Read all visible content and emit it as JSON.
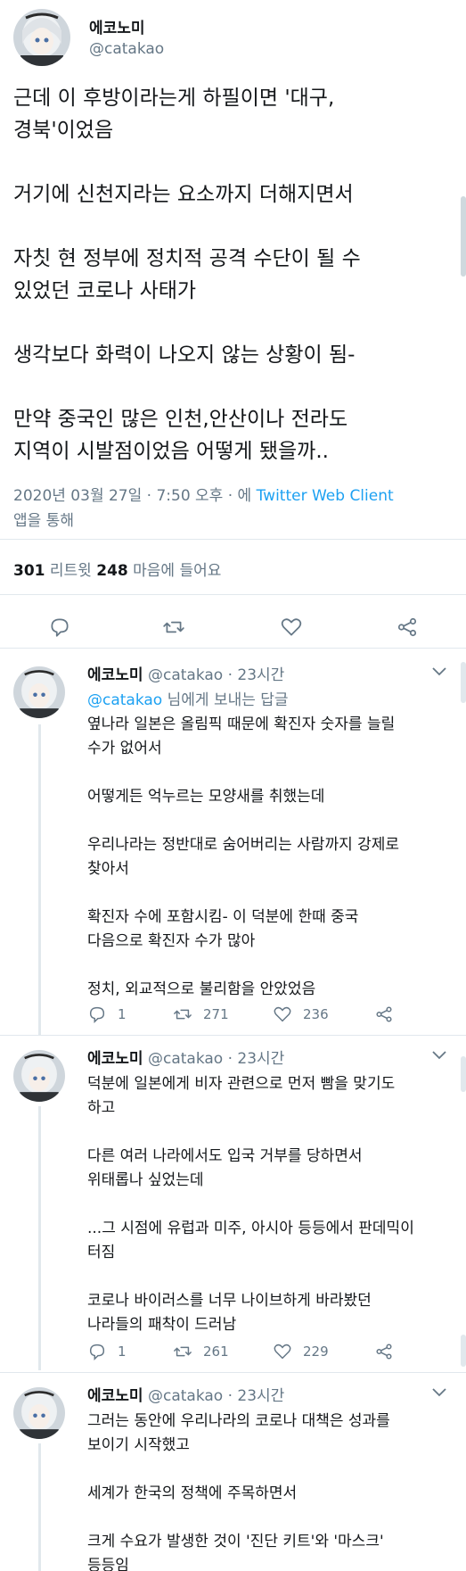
{
  "main_tweet": {
    "author_name": "에코노미",
    "author_handle": "@catakao",
    "lines": [
      "근데 이 후방이라는게 하필이면 '대구,",
      "경북'이었음",
      "",
      "거기에 신천지라는 요소까지 더해지면서",
      "",
      "자칫 현 정부에 정치적 공격 수단이 될 수",
      "있었던 코로나 사태가",
      "",
      "생각보다 화력이 나오지 않는 상황이 됨-",
      "",
      "만약 중국인 많은 인천,안산이나 전라도",
      "지역이 시발점이었음 어떻게 됐을까.."
    ],
    "timestamp": "2020년 03월 27일 · 7:50 오후 · 에 ",
    "client": "Twitter Web Client",
    "via": "앱을 통해",
    "retweet_count": "301",
    "retweet_label": " 리트윗 ",
    "like_count": "248",
    "like_label": " 마음에 들어요"
  },
  "replies": [
    {
      "author_name": "에코노미",
      "author_handle": "@catakao · 23시간",
      "replying_mention": "@catakao",
      "replying_suffix": " 님에게 보내는 답글",
      "lines": [
        "옆나라 일본은 올림픽 때문에 확진자 숫자를 늘릴",
        "수가 없어서",
        "",
        "어떻게든 억누르는 모양새를 취했는데",
        "",
        "우리나라는 정반대로 숨어버리는 사람까지 강제로",
        "찾아서",
        "",
        "확진자 수에 포함시킴- 이 덕분에 한때 중국",
        "다음으로 확진자 수가 많아",
        "",
        "정치, 외교적으로 불리함을 안았었음"
      ],
      "reply_count": "1",
      "retweet_count": "271",
      "like_count": "236"
    },
    {
      "author_name": "에코노미",
      "author_handle": "@catakao · 23시간",
      "lines": [
        "덕분에 일본에게 비자 관련으로 먼저 빰을 맞기도",
        "하고",
        "",
        "다른 여러 나라에서도 입국 거부를 당하면서",
        "위태롭나 싶었는데",
        "",
        "...그 시점에 유럽과 미주, 아시아 등등에서 판데믹이",
        "터짐",
        "",
        "코로나 바이러스를 너무 나이브하게 바라봤던",
        "나라들의 패착이 드러남"
      ],
      "reply_count": "1",
      "retweet_count": "261",
      "like_count": "229"
    },
    {
      "author_name": "에코노미",
      "author_handle": "@catakao · 23시간",
      "lines": [
        "그러는 동안에 우리나라의 코로나 대책은 성과를",
        "보이기 시작했고",
        "",
        "세계가 한국의 정책에 주목하면서",
        "",
        "크게 수요가 발생한 것이 '진단 키트'와 '마스크'",
        "등등임"
      ]
    }
  ],
  "icons": {
    "reply": "reply-icon",
    "retweet": "retweet-icon",
    "like": "heart-icon",
    "share": "share-icon"
  },
  "colors": {
    "link": "#1da1f2",
    "secondary_text": "#657786",
    "divider": "#e1e8ed"
  }
}
